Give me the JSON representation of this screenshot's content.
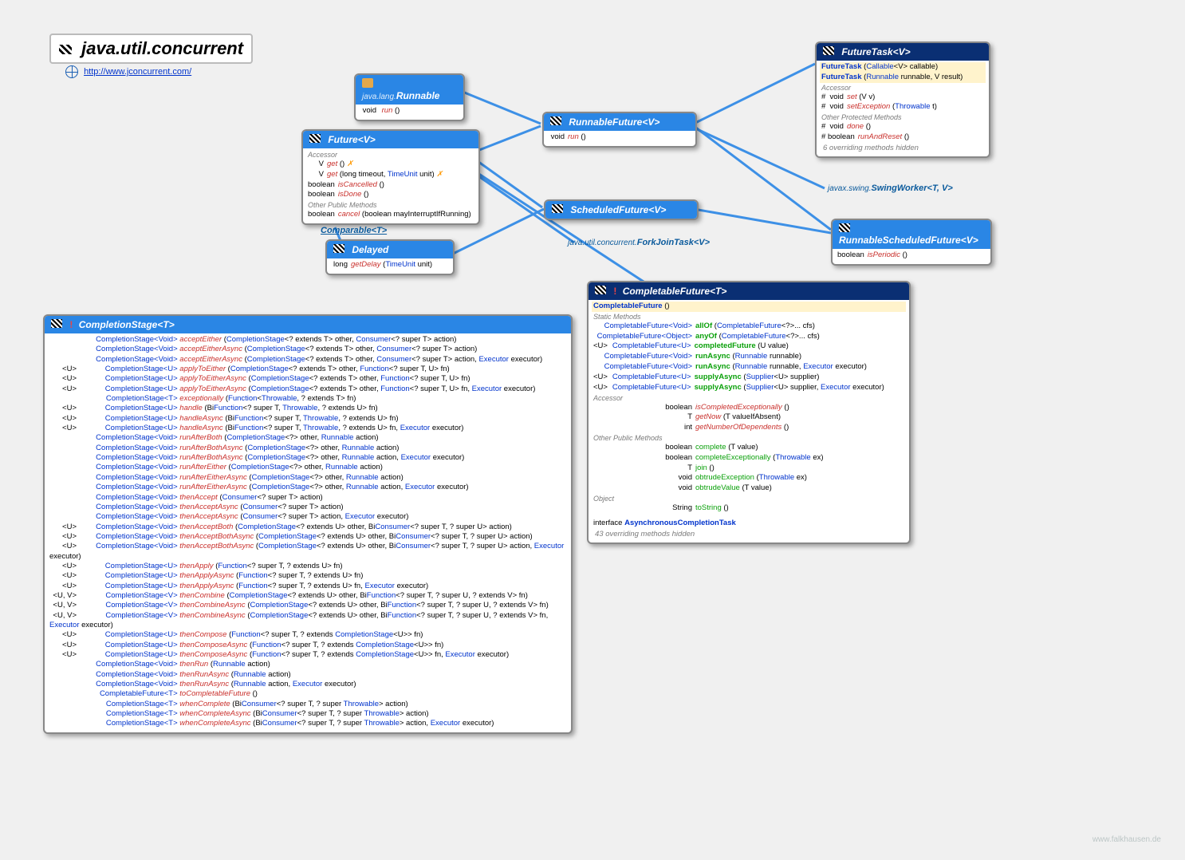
{
  "page": {
    "title": "java.util.concurrent",
    "site": "http://www.jconcurrent.com/",
    "footer": "www.falkhausen.de"
  },
  "runnable": {
    "header_pkg": "java.lang.",
    "header_name": "Runnable",
    "row1_ret": "void",
    "row1_name": "run",
    "row1_params": " ()"
  },
  "future": {
    "header_name": "Future",
    "header_tparam": "<V>",
    "sect_accessor": "Accessor",
    "r1_ret": "V",
    "r1_name": "get",
    "r1_params": " ()",
    "r2_ret": "V",
    "r2_name": "get",
    "r2_params": " (long timeout, ",
    "r2_tu": "TimeUnit",
    "r2_tail": " unit)",
    "r3_ret": "boolean",
    "r3_name": "isCancelled",
    "r3_params": " ()",
    "r4_ret": "boolean",
    "r4_name": "isDone",
    "r4_params": " ()",
    "sect_other": "Other Public Methods",
    "r5_ret": "boolean",
    "r5_name": "cancel",
    "r5_params": " (boolean mayInterruptIfRunning)",
    "ex_marker": " ✗"
  },
  "comparable_ref": "Comparable<T>",
  "delayed": {
    "header_name": "Delayed",
    "r1_ret": "long",
    "r1_name": "getDelay",
    "r1_p1": " (",
    "r1_tu": "TimeUnit",
    "r1_tail": " unit)"
  },
  "runnablefuture": {
    "header_name": "RunnableFuture",
    "header_tparam": "<V>",
    "r1_ret": "void",
    "r1_name": "run",
    "r1_params": " ()"
  },
  "scheduledfuture": {
    "header_name": "ScheduledFuture",
    "header_tparam": "<V>"
  },
  "futuretask": {
    "header_name": "FutureTask",
    "header_tparam": "<V>",
    "c1_name": "FutureTask",
    "c1_p": " (",
    "c1_t1": "Callable",
    "c1_tail": "<V> callable)",
    "c2_name": "FutureTask",
    "c2_p": " (",
    "c2_t1": "Runnable",
    "c2_tail": " runnable, V result)",
    "sect_accessor": "Accessor",
    "r1_mod": "#",
    "r1_ret": "void",
    "r1_name": "set",
    "r1_params": " (V v)",
    "r2_mod": "#",
    "r2_ret": "void",
    "r2_name": "setException",
    "r2_p": " (",
    "r2_t": "Throwable",
    "r2_tail": " t)",
    "sect_other": "Other Protected Methods",
    "r3_mod": "#",
    "r3_ret": "void",
    "r3_name": "done",
    "r3_params": " ()",
    "r4_mod": "#",
    "r4_ret": "boolean",
    "r4_name": "runAndReset",
    "r4_params": " ()",
    "note": "6 overriding methods hidden"
  },
  "runnablesched": {
    "header_name": "RunnableScheduledFuture",
    "header_tparam": "<V>",
    "r1_ret": "boolean",
    "r1_name": "isPeriodic",
    "r1_params": " ()"
  },
  "ext_swingworker_pkg": "javax.swing.",
  "ext_swingworker_name": "SwingWorker<T, V>",
  "ext_forkjoin_pkg": "java.util.concurrent.",
  "ext_forkjoin_name": "ForkJoinTask<V>",
  "completable": {
    "header_name": "CompletableFuture",
    "header_tparam": "<T>",
    "ctor_name": "CompletableFuture",
    "ctor_params": " ()",
    "sect_static": "Static Methods",
    "s1_ret": "CompletableFuture<Void>",
    "s1_name": "allOf",
    "s1_p": " (",
    "s1_t": "CompletableFuture",
    "s1_tail": "<?>... cfs)",
    "s2_ret": "CompletableFuture<Object>",
    "s2_name": "anyOf",
    "s2_p": " (",
    "s2_t": "CompletableFuture",
    "s2_tail": "<?>... cfs)",
    "s3_pre": "<U>",
    "s3_ret": "CompletableFuture<U>",
    "s3_name": "completedFuture",
    "s3_params": " (U value)",
    "s4_ret": "CompletableFuture<Void>",
    "s4_name": "runAsync",
    "s4_p": " (",
    "s4_t": "Runnable",
    "s4_tail": " runnable)",
    "s5_ret": "CompletableFuture<Void>",
    "s5_name": "runAsync",
    "s5_p": " (",
    "s5_t1": "Runnable",
    "s5_mid": " runnable, ",
    "s5_t2": "Executor",
    "s5_tail": " executor)",
    "s6_pre": "<U>",
    "s6_ret": "CompletableFuture<U>",
    "s6_name": "supplyAsync",
    "s6_p": " (",
    "s6_t": "Supplier",
    "s6_tail": "<U> supplier)",
    "s7_pre": "<U>",
    "s7_ret": "CompletableFuture<U>",
    "s7_name": "supplyAsync",
    "s7_p": " (",
    "s7_t1": "Supplier",
    "s7_mid": "<U> supplier, ",
    "s7_t2": "Executor",
    "s7_tail": " executor)",
    "sect_accessor": "Accessor",
    "a1_ret": "boolean",
    "a1_name": "isCompletedExceptionally",
    "a1_params": " ()",
    "a2_ret": "T",
    "a2_name": "getNow",
    "a2_params": " (T valueIfAbsent)",
    "a3_ret": "int",
    "a3_name": "getNumberOfDependents",
    "a3_params": " ()",
    "sect_other": "Other Public Methods",
    "o1_ret": "boolean",
    "o1_name": "complete",
    "o1_params": " (T value)",
    "o2_ret": "boolean",
    "o2_name": "completeExceptionally",
    "o2_p": " (",
    "o2_t": "Throwable",
    "o2_tail": " ex)",
    "o3_ret": "T",
    "o3_name": "join",
    "o3_params": " ()",
    "o4_ret": "void",
    "o4_name": "obtrudeException",
    "o4_p": " (",
    "o4_t": "Throwable",
    "o4_tail": " ex)",
    "o5_ret": "void",
    "o5_name": "obtrudeValue",
    "o5_params": " (T value)",
    "sect_object": "Object",
    "ob1_ret": "String",
    "ob1_name": "toString",
    "ob1_params": " ()",
    "inner_label": "interface ",
    "inner_name": "AsynchronousCompletionTask",
    "note": "43 overriding methods hidden"
  },
  "comp_stage": {
    "header_name": "CompletionStage",
    "header_tparam": "<T>",
    "rows": [
      {
        "pre": "",
        "ret": "CompletionStage<Void>",
        "name": "acceptEither",
        "sig": "(CompletionStage<? extends T> other, Consumer<? super T> action)"
      },
      {
        "pre": "",
        "ret": "CompletionStage<Void>",
        "name": "acceptEitherAsync",
        "sig": "(CompletionStage<? extends T> other, Consumer<? super T> action)"
      },
      {
        "pre": "",
        "ret": "CompletionStage<Void>",
        "name": "acceptEitherAsync",
        "sig": "(CompletionStage<? extends T> other, Consumer<? super T> action, Executor executor)"
      },
      {
        "pre": "<U>",
        "ret": "CompletionStage<U>",
        "name": "applyToEither",
        "sig": "(CompletionStage<? extends T>  other, Function<? super T, U> fn)"
      },
      {
        "pre": "<U>",
        "ret": "CompletionStage<U>",
        "name": "applyToEitherAsync",
        "sig": "(CompletionStage<? extends T>  other, Function<? super T, U> fn)"
      },
      {
        "pre": "<U>",
        "ret": "CompletionStage<U>",
        "name": "applyToEitherAsync",
        "sig": "(CompletionStage<? extends T>  other, Function<? super T, U> fn, Executor executor)"
      },
      {
        "pre": "",
        "ret": "CompletionStage<T>",
        "name": "exceptionally",
        "sig": "(Function<Throwable, ? extends T> fn)"
      },
      {
        "pre": "<U>",
        "ret": "CompletionStage<U>",
        "name": "handle",
        "sig": "(BiFunction<? super T, Throwable, ? extends U> fn)"
      },
      {
        "pre": "<U>",
        "ret": "CompletionStage<U>",
        "name": "handleAsync",
        "sig": "(BiFunction<? super T, Throwable, ? extends U> fn)"
      },
      {
        "pre": "<U>",
        "ret": "CompletionStage<U>",
        "name": "handleAsync",
        "sig": "(BiFunction<? super T, Throwable, ? extends U> fn, Executor executor)"
      },
      {
        "pre": "",
        "ret": "CompletionStage<Void>",
        "name": "runAfterBoth",
        "sig": "(CompletionStage<?> other, Runnable action)"
      },
      {
        "pre": "",
        "ret": "CompletionStage<Void>",
        "name": "runAfterBothAsync",
        "sig": "(CompletionStage<?> other, Runnable action)"
      },
      {
        "pre": "",
        "ret": "CompletionStage<Void>",
        "name": "runAfterBothAsync",
        "sig": "(CompletionStage<?> other, Runnable action, Executor executor)"
      },
      {
        "pre": "",
        "ret": "CompletionStage<Void>",
        "name": "runAfterEither",
        "sig": "(CompletionStage<?> other, Runnable action)"
      },
      {
        "pre": "",
        "ret": "CompletionStage<Void>",
        "name": "runAfterEitherAsync",
        "sig": "(CompletionStage<?> other, Runnable action)"
      },
      {
        "pre": "",
        "ret": "CompletionStage<Void>",
        "name": "runAfterEitherAsync",
        "sig": "(CompletionStage<?> other, Runnable action, Executor executor)"
      },
      {
        "pre": "",
        "ret": "CompletionStage<Void>",
        "name": "thenAccept",
        "sig": "(Consumer<? super T> action)"
      },
      {
        "pre": "",
        "ret": "CompletionStage<Void>",
        "name": "thenAcceptAsync",
        "sig": "(Consumer<? super T> action)"
      },
      {
        "pre": "",
        "ret": "CompletionStage<Void>",
        "name": "thenAcceptAsync",
        "sig": "(Consumer<? super T> action, Executor executor)"
      },
      {
        "pre": "<U>",
        "ret": "CompletionStage<Void>",
        "name": "thenAcceptBoth",
        "sig": "(CompletionStage<? extends U> other, BiConsumer<? super T, ? super U> action)"
      },
      {
        "pre": "<U>",
        "ret": "CompletionStage<Void>",
        "name": "thenAcceptBothAsync",
        "sig": "(CompletionStage<? extends U> other, BiConsumer<? super T, ? super U> action)"
      },
      {
        "pre": "<U>",
        "ret": "CompletionStage<Void>",
        "name": "thenAcceptBothAsync",
        "sig": "(CompletionStage<? extends U> other, BiConsumer<? super T, ? super U> action, Executor executor)"
      },
      {
        "pre": "<U>",
        "ret": "CompletionStage<U>",
        "name": "thenApply",
        "sig": "(Function<? super T, ? extends U>  fn)"
      },
      {
        "pre": "<U>",
        "ret": "CompletionStage<U>",
        "name": "thenApplyAsync",
        "sig": "(Function<? super T, ? extends U>  fn)"
      },
      {
        "pre": "<U>",
        "ret": "CompletionStage<U>",
        "name": "thenApplyAsync",
        "sig": "(Function<? super T, ? extends U>  fn, Executor executor)"
      },
      {
        "pre": "<U, V>",
        "ret": "CompletionStage<V>",
        "name": "thenCombine",
        "sig": "(CompletionStage<? extends U>  other, BiFunction<? super T, ? super U, ? extends V> fn)"
      },
      {
        "pre": "<U, V>",
        "ret": "CompletionStage<V>",
        "name": "thenCombineAsync",
        "sig": "(CompletionStage<? extends U>  other, BiFunction<? super T, ? super U, ? extends V> fn)"
      },
      {
        "pre": "<U, V>",
        "ret": "CompletionStage<V>",
        "name": "thenCombineAsync",
        "sig": "(CompletionStage<? extends U>  other, BiFunction<? super T, ? super U, ? extends V> fn, Executor executor)"
      },
      {
        "pre": "<U>",
        "ret": "CompletionStage<U>",
        "name": "thenCompose",
        "sig": "(Function<? super T, ? extends CompletionStage<U>> fn)"
      },
      {
        "pre": "<U>",
        "ret": "CompletionStage<U>",
        "name": "thenComposeAsync",
        "sig": "(Function<? super T, ? extends CompletionStage<U>> fn)"
      },
      {
        "pre": "<U>",
        "ret": "CompletionStage<U>",
        "name": "thenComposeAsync",
        "sig": "(Function<? super T, ? extends CompletionStage<U>> fn, Executor executor)"
      },
      {
        "pre": "",
        "ret": "CompletionStage<Void>",
        "name": "thenRun",
        "sig": "(Runnable action)"
      },
      {
        "pre": "",
        "ret": "CompletionStage<Void>",
        "name": "thenRunAsync",
        "sig": "(Runnable action)"
      },
      {
        "pre": "",
        "ret": "CompletionStage<Void>",
        "name": "thenRunAsync",
        "sig": "(Runnable action, Executor executor)"
      },
      {
        "pre": "",
        "ret": "CompletableFuture<T>",
        "name": "toCompletableFuture",
        "sig": "()"
      },
      {
        "pre": "",
        "ret": "CompletionStage<T>",
        "name": "whenComplete",
        "sig": "(BiConsumer<? super T, ? super Throwable>  action)"
      },
      {
        "pre": "",
        "ret": "CompletionStage<T>",
        "name": "whenCompleteAsync",
        "sig": "(BiConsumer<? super T, ? super Throwable> action)"
      },
      {
        "pre": "",
        "ret": "CompletionStage<T>",
        "name": "whenCompleteAsync",
        "sig": "(BiConsumer<? super T, ? super Throwable> action, Executor executor)"
      }
    ]
  }
}
